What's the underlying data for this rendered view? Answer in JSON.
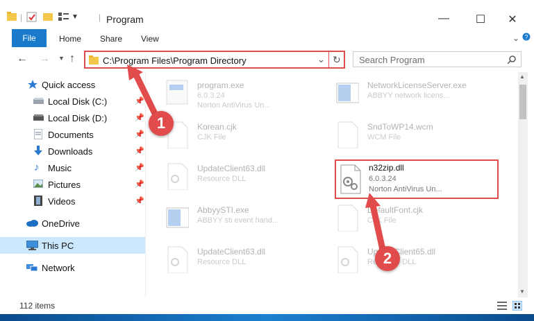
{
  "window": {
    "title": "Program",
    "minimize": "—",
    "maximize": "☐",
    "close": "✕"
  },
  "ribbon": {
    "tabs": [
      "File",
      "Home",
      "Share",
      "View"
    ]
  },
  "address": {
    "path": "C:\\Program Files\\Program Directory"
  },
  "search": {
    "placeholder": "Search Program"
  },
  "sidebar": {
    "items": [
      {
        "label": "Quick access"
      },
      {
        "label": "Local Disk (C:)"
      },
      {
        "label": "Local Disk (D:)"
      },
      {
        "label": "Documents"
      },
      {
        "label": "Downloads"
      },
      {
        "label": "Music"
      },
      {
        "label": "Pictures"
      },
      {
        "label": "Videos"
      },
      {
        "label": "OneDrive"
      },
      {
        "label": "This PC"
      },
      {
        "label": "Network"
      }
    ]
  },
  "files": [
    {
      "name": "program.exe",
      "line1": "6.0.3.24",
      "line2": "Norton AntiVirus Un..."
    },
    {
      "name": "NetworkLicenseServer.exe",
      "line1": "ABBYY network licens...",
      "line2": ""
    },
    {
      "name": "Korean.cjk",
      "line1": "CJK File",
      "line2": ""
    },
    {
      "name": "SndToWP14.wcm",
      "line1": "WCM File",
      "line2": ""
    },
    {
      "name": "UpdateClient63.dll",
      "line1": "Resource DLL",
      "line2": ""
    },
    {
      "name": "n32zip.dll",
      "line1": "6.0.3.24",
      "line2": "Norton AntiVirus Un..."
    },
    {
      "name": "AbbyySTI.exe",
      "line1": "ABBYY sti event hand...",
      "line2": ""
    },
    {
      "name": "DefaultFont.cjk",
      "line1": "CJK File",
      "line2": ""
    },
    {
      "name": "UpdateClient63.dll",
      "line1": "Resource DLL",
      "line2": ""
    },
    {
      "name": "UpdateClient65.dll",
      "line1": "Resource DLL",
      "line2": ""
    }
  ],
  "status": {
    "count": "112 items"
  },
  "callouts": {
    "one": "1",
    "two": "2"
  }
}
